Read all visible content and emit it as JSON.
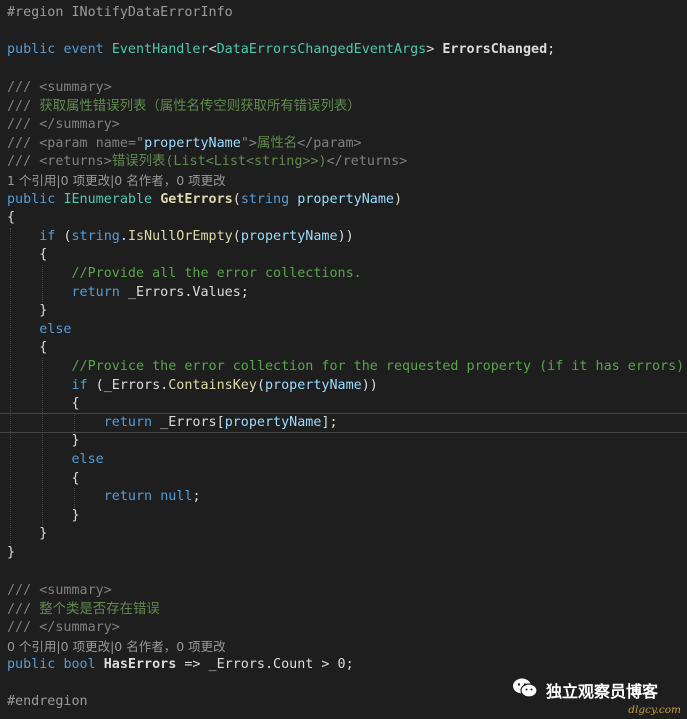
{
  "code": {
    "region_start": "#region INotifyDataErrorInfo",
    "event_decl": {
      "kw1": "public",
      "kw2": "event",
      "type1": "EventHandler",
      "lt": "<",
      "type2": "DataErrorsChangedEventArgs",
      "gt": ">",
      "name": "ErrorsChanged",
      "semi": ";"
    },
    "doc1": [
      {
        "prefix": "/// ",
        "tag": "<summary>"
      },
      {
        "prefix": "/// ",
        "text": "获取属性错误列表（属性名传空则获取所有错误列表）"
      },
      {
        "prefix": "/// ",
        "tag": "</summary>"
      }
    ],
    "param_line": {
      "prefix": "/// ",
      "open": "<param ",
      "attr": "name",
      "eq": "=",
      "quote_open": "\"",
      "value": "propertyName",
      "quote_close": "\"",
      "close": ">",
      "text": "属性名",
      "end": "</param>"
    },
    "returns_line": {
      "prefix": "/// ",
      "open": "<returns>",
      "text": "错误列表(List<List<string>>)",
      "end": "</returns>"
    },
    "lens1": "1 个引用|0 项更改|0 名作者，0 项更改",
    "method_decl": {
      "kw": "public",
      "type": "IEnumerable",
      "name": "GetErrors",
      "open": "(",
      "ptype": "string",
      "pname": "propertyName",
      "close": ")"
    },
    "brace_open": "{",
    "brace_close": "}",
    "if1": {
      "kw": "if",
      "open": " (",
      "type": "string",
      "dot": ".",
      "fn": "IsNullOrEmpty",
      "p": "(",
      "arg": "propertyName",
      "close": "))"
    },
    "comment1": "//Provide all the error collections.",
    "return1": {
      "kw": "return",
      "expr": " _Errors.Values;"
    },
    "else_kw": "else",
    "comment2": "//Provice the error collection for the requested property (if it has errors).",
    "if2": {
      "kw": "if",
      "open": " (_Errors.",
      "fn": "ContainsKey",
      "p": "(",
      "arg": "propertyName",
      "close": "))"
    },
    "return2": {
      "kw": "return",
      "pre": " _Errors[",
      "arg": "propertyName",
      "post": "];"
    },
    "return3": {
      "kw": "return",
      "val": "null",
      "semi": ";"
    },
    "doc2": [
      {
        "prefix": "/// ",
        "tag": "<summary>"
      },
      {
        "prefix": "/// ",
        "text": "整个类是否存在错误"
      },
      {
        "prefix": "/// ",
        "tag": "</summary>"
      }
    ],
    "lens2": "0 个引用|0 项更改|0 名作者，0 项更改",
    "prop_decl": {
      "kw": "public",
      "type": "bool",
      "name": "HasErrors",
      "rest": " => _Errors.Count > 0;"
    },
    "region_end": "#endregion"
  },
  "watermark": {
    "title": "独立观察员博客",
    "url": "dlgcy.com"
  },
  "icons": {
    "wechat": "wechat-icon"
  },
  "colors": {
    "background": "#1e1e1e",
    "keyword": "#569cd6",
    "type": "#4ec9b0",
    "method": "#dcdcaa",
    "parameter": "#9cdcfe",
    "comment": "#57a64a"
  }
}
